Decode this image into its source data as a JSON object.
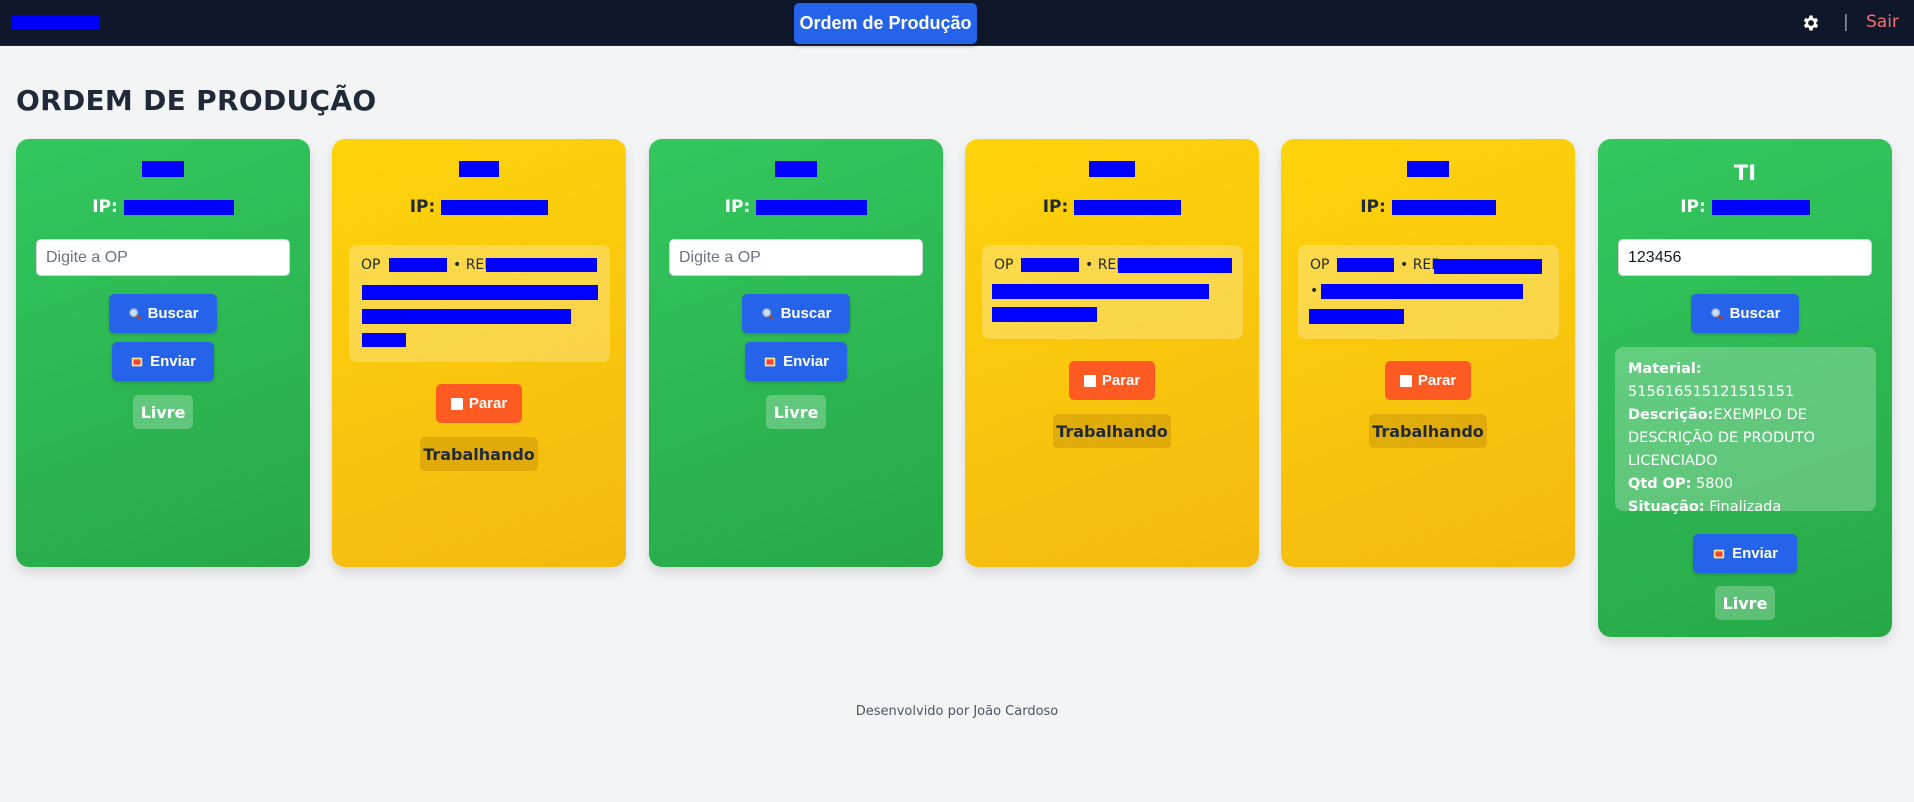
{
  "header": {
    "nav_button": "Ordem de Produção",
    "separator": "|",
    "logout": "Sair"
  },
  "page": {
    "title": "ORDEM DE PRODUÇÃO"
  },
  "cards": [
    {
      "color": "green",
      "ip_label": "IP:",
      "input_placeholder": "Digite a OP",
      "search_label": "Buscar",
      "send_label": "Enviar",
      "status": "Livre"
    },
    {
      "color": "yellow",
      "ip_label": "IP:",
      "op_prefix": "OP",
      "ref_prefix": "• REF:",
      "stop_label": "Parar",
      "status": "Trabalhando"
    },
    {
      "color": "green",
      "ip_label": "IP:",
      "input_placeholder": "Digite a OP",
      "search_label": "Buscar",
      "send_label": "Enviar",
      "status": "Livre"
    },
    {
      "color": "yellow",
      "ip_label": "IP:",
      "op_prefix": "OP",
      "ref_prefix": "• REF:",
      "stop_label": "Parar",
      "status": "Trabalhando"
    },
    {
      "color": "yellow",
      "ip_label": "IP:",
      "op_prefix": "OP",
      "ref_prefix": "• REF:",
      "bullet": "•",
      "stop_label": "Parar",
      "status": "Trabalhando"
    },
    {
      "color": "green",
      "name": "TI",
      "ip_label": "IP:",
      "input_value": "123456",
      "search_label": "Buscar",
      "material_label": "Material:",
      "material_value": "515616515121515151",
      "description_label": "Descrição:",
      "description_value": "EXEMPLO DE DESCRIÇÃO DE PRODUTO LICENCIADO",
      "qty_label": "Qtd OP:",
      "qty_value": "5800",
      "situation_label": "Situação:",
      "situation_value": "Finalizada",
      "send_label": "Enviar",
      "status": "Livre"
    }
  ],
  "footer": {
    "credit": "Desenvolvido por João Cardoso"
  },
  "colors": {
    "green": "#2fbf55",
    "yellow": "#fbc70f",
    "primary_blue": "#2563eb",
    "stop_orange": "#ff5a22",
    "topbar": "#0f172a",
    "redaction": "#0000ff"
  }
}
